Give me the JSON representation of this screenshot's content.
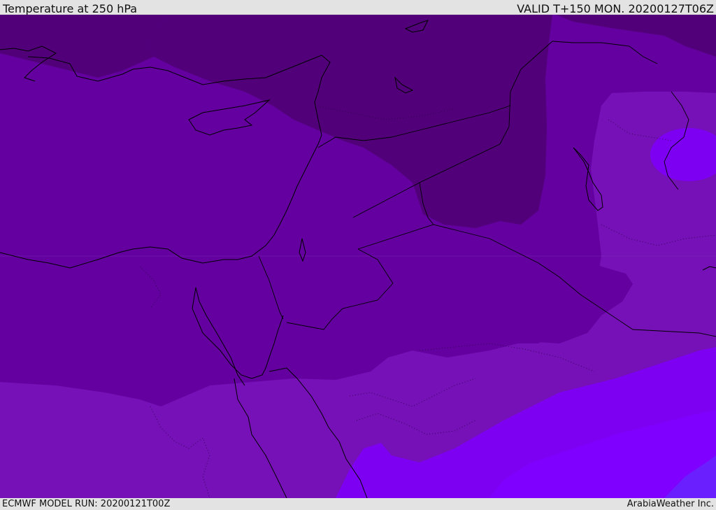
{
  "header": {
    "title": "Temperature at 250 hPa",
    "valid_time": "VALID T+150 MON. 20200127T06Z"
  },
  "footer": {
    "model_run": "ECMWF MODEL RUN: 20200121T00Z",
    "credit": "ArabiaWeather Inc."
  },
  "map": {
    "field": "Temperature at 250 hPa",
    "colors": {
      "darkest_band": "#51007a",
      "dark_band": "#63009f",
      "mid_band": "#7511b6",
      "light_band": "#7e00f2",
      "lightest_band": "#8000ff",
      "edge_band": "#6a1fff",
      "coastline": "#000000",
      "border": "#000000"
    }
  }
}
